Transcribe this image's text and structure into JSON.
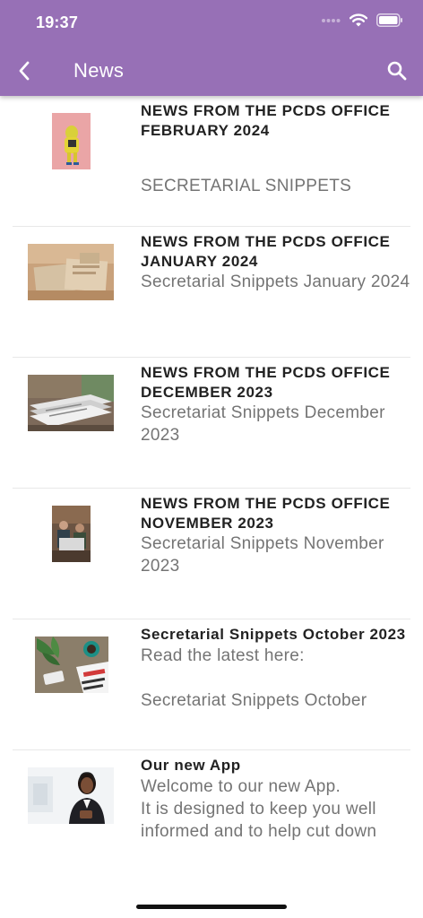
{
  "status_bar": {
    "time": "19:37"
  },
  "nav": {
    "title": "News",
    "back_icon": "chevron-left-icon",
    "search_icon": "search-icon"
  },
  "colors": {
    "header": "#9770b6",
    "title_text": "#222222",
    "desc_text": "#747474"
  },
  "news": [
    {
      "title": "NEWS FROM THE PCDS OFFICE FEBRUARY 2024",
      "desc1": "",
      "desc2": "SECRETARIAL SNIPPETS",
      "image": "person-in-yellow-suit-thumbnail"
    },
    {
      "title": "NEWS FROM THE PCDS OFFICE JANUARY 2024",
      "desc1": "Secretarial Snippets January 2024",
      "desc2": "",
      "image": "stacked-newspapers-thumbnail"
    },
    {
      "title": "NEWS FROM THE PCDS OFFICE DECEMBER 2023",
      "desc1": "Secretariat Snippets December 2023",
      "desc2": "",
      "image": "newspaper-pile-thumbnail"
    },
    {
      "title": "NEWS FROM THE PCDS OFFICE NOVEMBER 2023",
      "desc1": "Secretarial Snippets November 2023",
      "desc2": "",
      "image": "people-reading-thumbnail"
    },
    {
      "title": "Secretarial Snippets October 2023",
      "desc1": "Read the latest here:",
      "desc2": "Secretariat Snippets October",
      "image": "desk-with-phone-and-magazine-thumbnail"
    },
    {
      "title": "Our new App",
      "desc1": "Welcome to our new App.",
      "desc2": "It is designed to keep you well informed and to help cut down",
      "image": "woman-with-headset-thumbnail"
    }
  ]
}
